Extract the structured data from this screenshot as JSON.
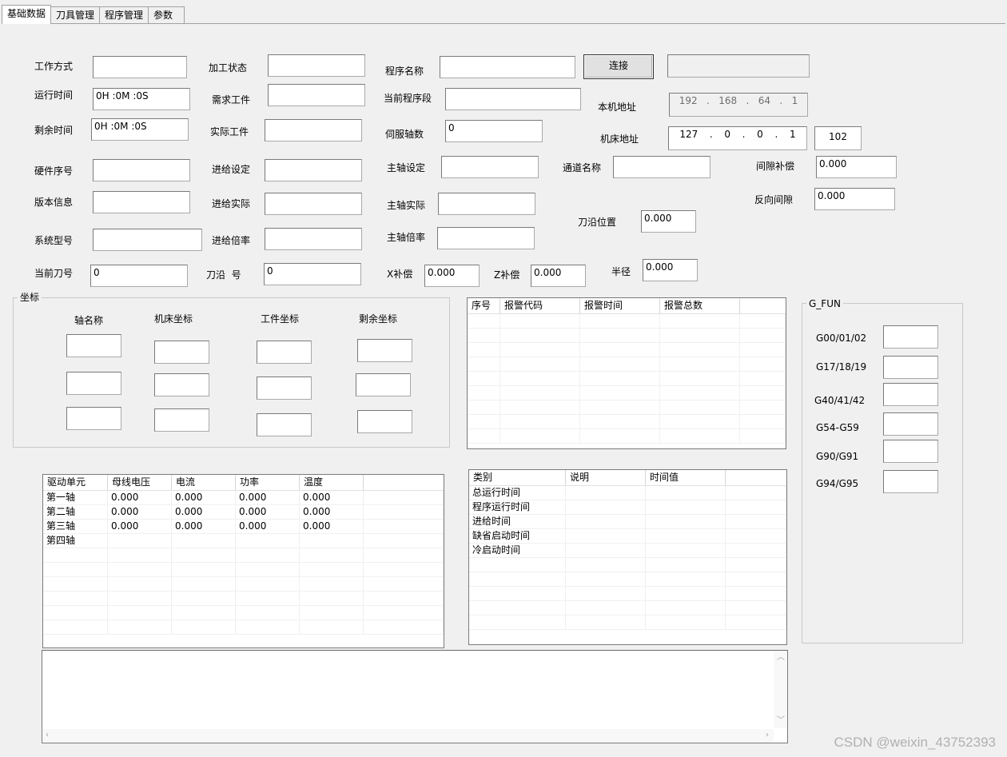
{
  "tabs": [
    "基础数据",
    "刀具管理",
    "程序管理",
    "参数"
  ],
  "fields": {
    "work_mode": {
      "label": "工作方式",
      "value": ""
    },
    "run_time": {
      "label": "运行时间",
      "value": "0H :0M :0S"
    },
    "remain_time": {
      "label": "剩余时间",
      "value": "0H :0M :0S"
    },
    "hw_serial": {
      "label": "硬件序号",
      "value": ""
    },
    "version": {
      "label": "版本信息",
      "value": ""
    },
    "sys_model": {
      "label": "系统型号",
      "value": ""
    },
    "cur_tool": {
      "label": "当前刀号",
      "value": "0"
    },
    "proc_state": {
      "label": "加工状态",
      "value": ""
    },
    "need_parts": {
      "label": "需求工件",
      "value": ""
    },
    "actual_parts": {
      "label": "实际工件",
      "value": ""
    },
    "feed_set": {
      "label": "进给设定",
      "value": ""
    },
    "feed_actual": {
      "label": "进给实际",
      "value": ""
    },
    "feed_rate": {
      "label": "进给倍率",
      "value": ""
    },
    "tool_edge_no": {
      "label": "刀沿  号",
      "value": "0"
    },
    "prog_name": {
      "label": "程序名称",
      "value": ""
    },
    "cur_block": {
      "label": "当前程序段",
      "value": ""
    },
    "servo_axes": {
      "label": "伺服轴数",
      "value": "0"
    },
    "spindle_set": {
      "label": "主轴设定",
      "value": ""
    },
    "spindle_actual": {
      "label": "主轴实际",
      "value": ""
    },
    "spindle_rate": {
      "label": "主轴倍率",
      "value": ""
    },
    "x_comp": {
      "label": "X补偿",
      "value": "0.000"
    },
    "z_comp": {
      "label": "Z补偿",
      "value": "0.000"
    },
    "radius": {
      "label": "半径",
      "value": "0.000"
    },
    "channel": {
      "label": "通道名称",
      "value": ""
    },
    "tool_edge_pos": {
      "label": "刀沿位置",
      "value": "0.000"
    },
    "backlash_comp": {
      "label": "间隙补偿",
      "value": "0.000"
    },
    "reverse_gap": {
      "label": "反向间隙",
      "value": "0.000"
    }
  },
  "connect": {
    "button": "连接",
    "status": "",
    "local_label": "本机地址",
    "local_ip": [
      "192",
      "168",
      "64",
      "1"
    ],
    "machine_label": "机床地址",
    "machine_ip": [
      "127",
      "0",
      "0",
      "1"
    ],
    "port": "102",
    "dot": "."
  },
  "coords": {
    "title": "坐标",
    "headers": [
      "轴名称",
      "机床坐标",
      "工件坐标",
      "剩余坐标"
    ]
  },
  "alarms": {
    "headers": [
      "序号",
      "报警代码",
      "报警时间",
      "报警总数"
    ]
  },
  "gfun": {
    "title": "G_FUN",
    "items": [
      "G00/01/02",
      "G17/18/19",
      "G40/41/42",
      "G54-G59",
      "G90/G91",
      "G94/G95"
    ]
  },
  "drives": {
    "headers": [
      "驱动单元",
      "母线电压",
      "电流",
      "功率",
      "温度"
    ],
    "rows": [
      [
        "第一轴",
        "0.000",
        "0.000",
        "0.000",
        "0.000"
      ],
      [
        "第二轴",
        "0.000",
        "0.000",
        "0.000",
        "0.000"
      ],
      [
        "第三轴",
        "0.000",
        "0.000",
        "0.000",
        "0.000"
      ],
      [
        "第四轴",
        "",
        "",
        "",
        ""
      ]
    ]
  },
  "times": {
    "headers": [
      "类别",
      "说明",
      "时间值"
    ],
    "rows": [
      [
        "总运行时间",
        "",
        ""
      ],
      [
        "程序运行时间",
        "",
        ""
      ],
      [
        "进给时间",
        "",
        ""
      ],
      [
        "缺省启动时间",
        "",
        ""
      ],
      [
        "冷启动时间",
        "",
        ""
      ]
    ]
  },
  "log": {
    "text": ""
  },
  "watermark": "CSDN @weixin_43752393"
}
